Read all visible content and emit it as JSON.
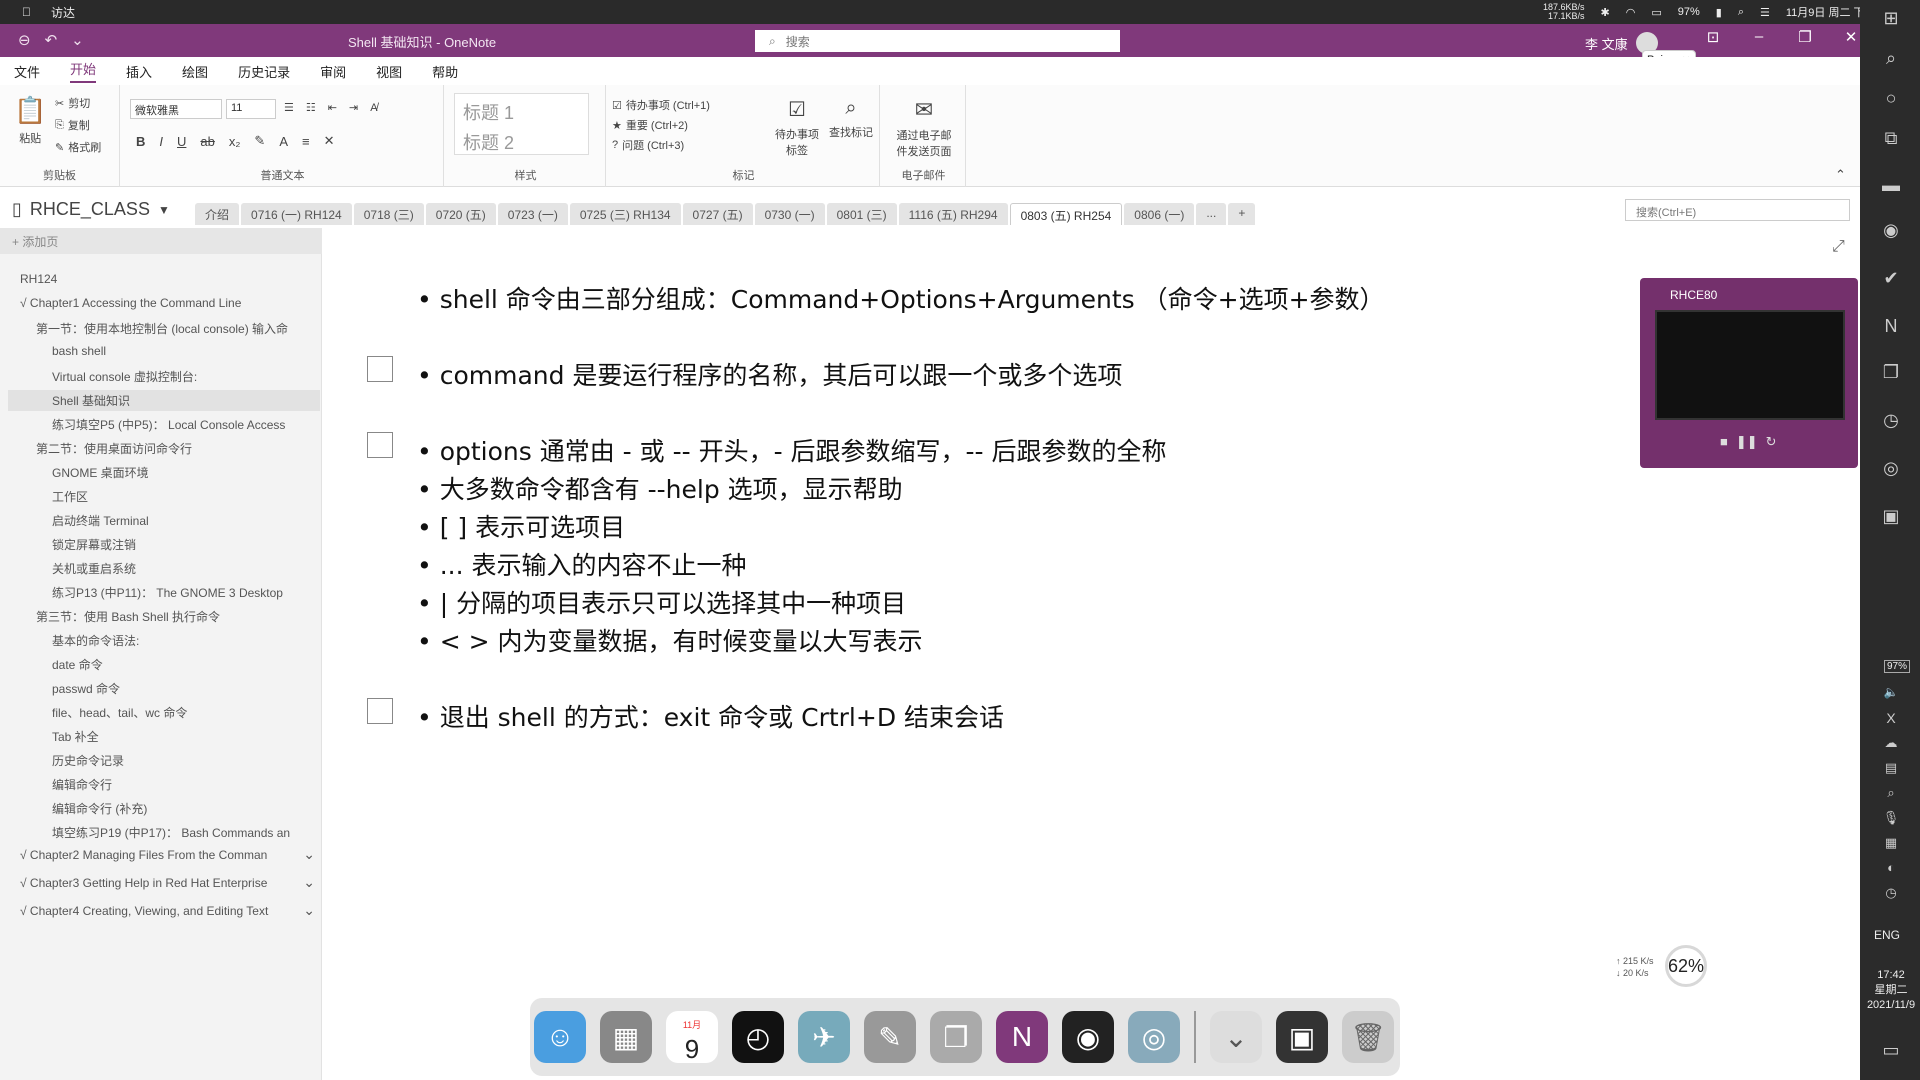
{
  "macbar": {
    "app": "访达",
    "net_up": "187.6KB/s",
    "net_down": "17.1KB/s",
    "battery": "97%",
    "datetime": "11月9日 周二 下午 5:42"
  },
  "title": {
    "text": "Shell 基础知识 - OneNote",
    "search": "搜索",
    "user": "李 文康"
  },
  "menu": [
    "文件",
    "开始",
    "插入",
    "绘图",
    "历史记录",
    "审阅",
    "视图",
    "帮助"
  ],
  "ribbon": {
    "paste": "粘贴",
    "cut": "剪切",
    "copy": "复制",
    "format_painter": "格式刷",
    "clipboard": "剪贴板",
    "font": "微软雅黑",
    "size": "11",
    "basic_text": "普通文本",
    "heading1": "标题 1",
    "heading2": "标题 2",
    "styles": "样式",
    "todo": "待办事项 (Ctrl+1)",
    "important": "重要 (Ctrl+2)",
    "question": "问题 (Ctrl+3)",
    "todo_tag": "待办事项标签",
    "find_tags": "查找标记",
    "tags": "标记",
    "email_page": "通过电子邮件发送页面",
    "email": "电子邮件"
  },
  "notebook": {
    "name": "RHCE_CLASS",
    "search": "搜索(Ctrl+E)"
  },
  "tabs": [
    "介绍",
    "0716 (一) RH124",
    "0718 (三)",
    "0720 (五)",
    "0723 (一)",
    "0725 (三) RH134",
    "0727 (五)",
    "0730 (一)",
    "0801 (三)",
    "1116 (五) RH294",
    "0803 (五) RH254",
    "0806 (一)",
    "...",
    "+"
  ],
  "sidebar": {
    "add": "添加页",
    "pages": [
      "RH124",
      "√ Chapter1 Accessing the Command Line",
      "第一节：使用本地控制台 (local console) 输入命",
      "bash shell",
      "Virtual console 虚拟控制台:",
      "Shell 基础知识",
      "练习填空P5 (中P5)： Local Console Access",
      "第二节：使用桌面访问命令行",
      "GNOME 桌面环境",
      "工作区",
      "启动终端 Terminal",
      "锁定屏幕或注销",
      "关机或重启系统",
      "练习P13 (中P11)： The GNOME 3 Desktop",
      "第三节：使用 Bash Shell 执行命令",
      "基本的命令语法:",
      "date 命令",
      "passwd 命令",
      "file、head、tail、wc 命令",
      "Tab 补全",
      "历史命令记录",
      "编辑命令行",
      "编辑命令行 (补充)",
      "填空练习P19 (中P17)： Bash Commands an",
      "√ Chapter2 Managing Files From the Comman",
      "√ Chapter3 Getting Help in Red Hat Enterprise",
      "√ Chapter4 Creating, Viewing, and Editing Text"
    ]
  },
  "note": {
    "lines": [
      "• shell 命令由三部分组成：Command+Options+Arguments （命令+选项+参数）",
      "• command 是要运行程序的名称，其后可以跟一个或多个选项",
      "• options 通常由 - 或 -- 开头，- 后跟参数缩写，-- 后跟参数的全称",
      "• 大多数命令都含有 --help 选项，显示帮助",
      "• [ ] 表示可选项目",
      "• ... 表示输入的内容不止一种",
      "• | 分隔的项目表示只可以选择其中一种项目",
      "• < > 内为变量数据，有时候变量以大写表示",
      "• 退出 shell 的方式：exit 命令或 Crtrl+D 结束会话"
    ]
  },
  "vm": {
    "title": "RHCE80"
  },
  "tip": {
    "label": "Poi...",
    "button": "开始"
  },
  "net_small": {
    "up": "↑ 215 K/s",
    "down": "↓ 20 K/s"
  },
  "gauge": "62%",
  "dock": {
    "calendar_day": "9",
    "calendar_month": "11月"
  },
  "rightbar": {
    "battery": "97%",
    "lang": "ENG",
    "time": "17:42",
    "day": "星期二",
    "date": "2021/11/9"
  }
}
